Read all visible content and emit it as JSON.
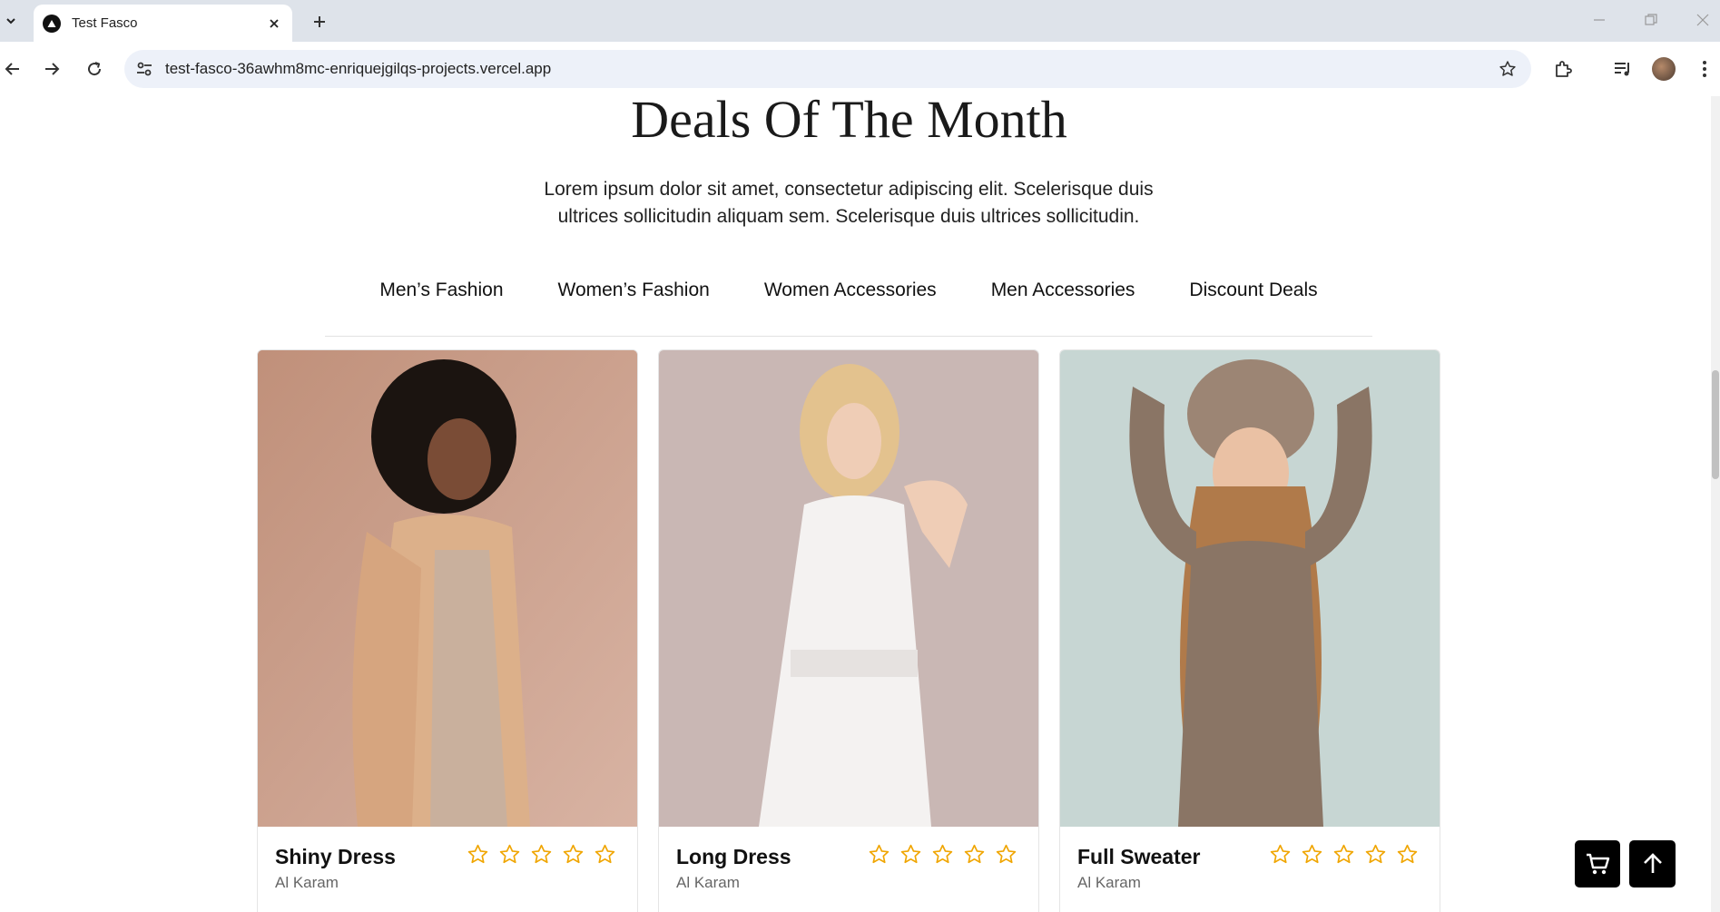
{
  "browser": {
    "tab_title": "Test Fasco",
    "url": "test-fasco-36awhm8mc-enriquejgilqs-projects.vercel.app"
  },
  "page": {
    "title": "Deals Of The Month",
    "description": "Lorem ipsum dolor sit amet, consectetur adipiscing elit. Scelerisque duis ultrices sollicitudin aliquam sem. Scelerisque duis ultrices sollicitudin.",
    "categories": [
      "Men’s Fashion",
      "Women’s Fashion",
      "Women Accessories",
      "Men Accessories",
      "Discount Deals"
    ],
    "products": [
      {
        "name": "Shiny Dress",
        "brand": "Al Karam",
        "rating": 0,
        "max_rating": 5
      },
      {
        "name": "Long Dress",
        "brand": "Al Karam",
        "rating": 0,
        "max_rating": 5
      },
      {
        "name": "Full Sweater",
        "brand": "Al Karam",
        "rating": 0,
        "max_rating": 5
      }
    ]
  },
  "icons": {
    "cart": "cart-icon",
    "scroll_top": "arrow-up-icon",
    "star": "star-outline-icon"
  },
  "colors": {
    "star": "#f0a500",
    "button_bg": "#000000"
  }
}
